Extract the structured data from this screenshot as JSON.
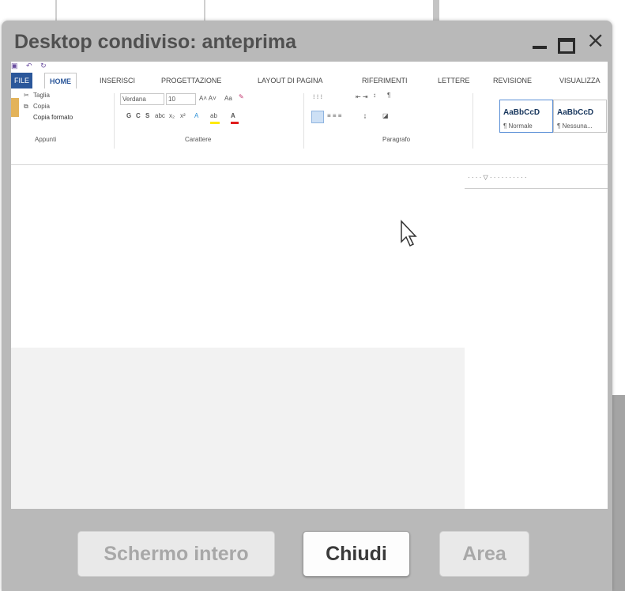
{
  "dialog": {
    "title": "Desktop condiviso: anteprima",
    "controls": {
      "minimize": "minimize-icon",
      "maximize": "maximize-icon",
      "close": "×"
    }
  },
  "word": {
    "tabs": [
      "FILE",
      "HOME",
      "INSERISCI",
      "PROGETTAZIONE",
      "LAYOUT DI PAGINA",
      "RIFERIMENTI",
      "LETTERE",
      "REVISIONE",
      "VISUALIZZA"
    ],
    "active_tab": "HOME",
    "clipboard": {
      "cut": "Taglia",
      "copy": "Copia",
      "format_painter": "Copia formato",
      "group": "Appunti"
    },
    "font": {
      "name": "Verdana",
      "size": "10",
      "group": "Carattere",
      "bold": "G",
      "italic": "C",
      "underline": "S"
    },
    "paragraph": {
      "group": "Paragrafo"
    },
    "styles": [
      {
        "preview": "AaBbCcD",
        "label": "¶ Normale"
      },
      {
        "preview": "AaBbCcD",
        "label": "¶ Nessuna..."
      }
    ]
  },
  "buttons": {
    "fullscreen": "Schermo intero",
    "close": "Chiudi",
    "area": "Area"
  },
  "colors": {
    "file_tab": "#2b579a",
    "highlight": "#ffea00",
    "font_color": "#e01d1d"
  }
}
